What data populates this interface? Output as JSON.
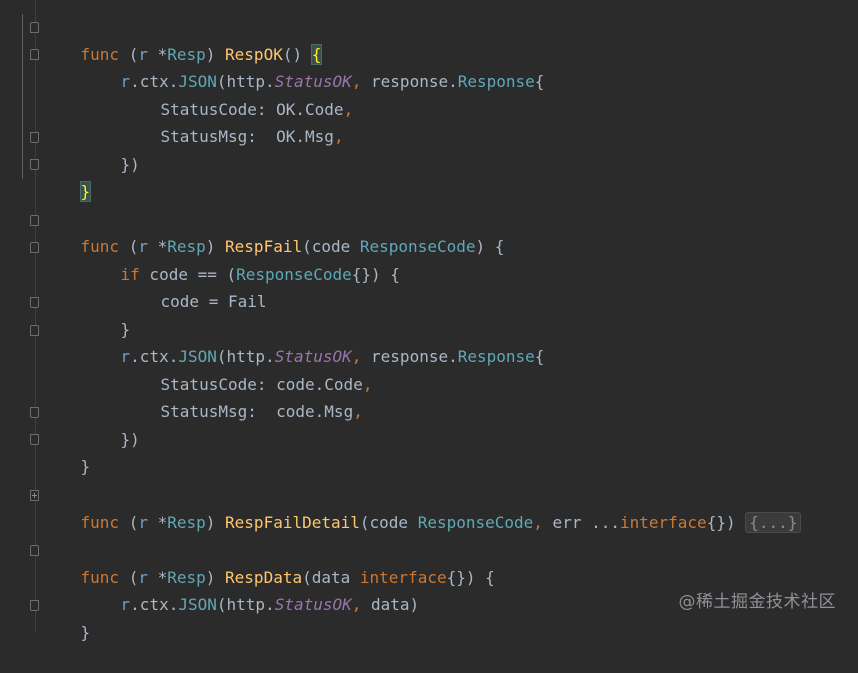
{
  "editor": {
    "watermark": "@稀土掘金技术社区"
  },
  "code": {
    "l1": {
      "kw": "func",
      "p1": " (",
      "recv": "r",
      "star": " *",
      "type": "Resp",
      "p2": ") ",
      "name": "RespOK",
      "p3": "() ",
      "brace": "{"
    },
    "l2": {
      "recv": "r",
      "p1": ".ctx.",
      "m": "JSON",
      "p2": "(",
      "pkg": "http",
      "dot": ".",
      "const": "StatusOK",
      "comma": ",",
      "p3": " ",
      "pkg2": "response",
      "dot2": ".",
      "type": "Response",
      "p4": "{"
    },
    "l3": {
      "field": "StatusCode",
      "p1": ": ",
      "obj": "OK",
      "p2": ".Code",
      "comma": ","
    },
    "l4": {
      "field": "StatusMsg",
      "p1": ":  ",
      "obj": "OK",
      "p2": ".Msg",
      "comma": ","
    },
    "l5": {
      "text": "})"
    },
    "l6": {
      "brace": "}"
    },
    "l7": {
      "kw": "func",
      "p1": " (",
      "recv": "r",
      "star": " *",
      "type": "Resp",
      "p2": ") ",
      "name": "RespFail",
      "p3": "(code ",
      "ptype": "ResponseCode",
      "p4": ") {"
    },
    "l8": {
      "kw": "if",
      "p1": " code == (",
      "type": "ResponseCode",
      "p2": "{}) {"
    },
    "l9": {
      "text": "code = Fail"
    },
    "l10": {
      "text": "}"
    },
    "l11": {
      "recv": "r",
      "p1": ".ctx.",
      "m": "JSON",
      "p2": "(",
      "pkg": "http",
      "dot": ".",
      "const": "StatusOK",
      "comma": ",",
      "p3": " ",
      "pkg2": "response",
      "dot2": ".",
      "type": "Response",
      "p4": "{"
    },
    "l12": {
      "field": "StatusCode",
      "p1": ": code.Code",
      "comma": ","
    },
    "l13": {
      "field": "StatusMsg",
      "p1": ":  code.Msg",
      "comma": ","
    },
    "l14": {
      "text": "})"
    },
    "l15": {
      "text": "}"
    },
    "l16": {
      "kw": "func",
      "p1": " (",
      "recv": "r",
      "star": " *",
      "type": "Resp",
      "p2": ") ",
      "name": "RespFailDetail",
      "p3": "(code ",
      "ptype": "ResponseCode",
      "comma": ",",
      "p4": " err ...",
      "kw2": "interface",
      "p5": "{}) ",
      "folded": "{...}"
    },
    "l17": {
      "kw": "func",
      "p1": " (",
      "recv": "r",
      "star": " *",
      "type": "Resp",
      "p2": ") ",
      "name": "RespData",
      "p3": "(data ",
      "kw2": "interface",
      "p4": "{}) {"
    },
    "l18": {
      "recv": "r",
      "p1": ".ctx.",
      "m": "JSON",
      "p2": "(",
      "pkg": "http",
      "dot": ".",
      "const": "StatusOK",
      "comma": ",",
      "p3": " data)"
    },
    "l19": {
      "text": "}"
    }
  }
}
